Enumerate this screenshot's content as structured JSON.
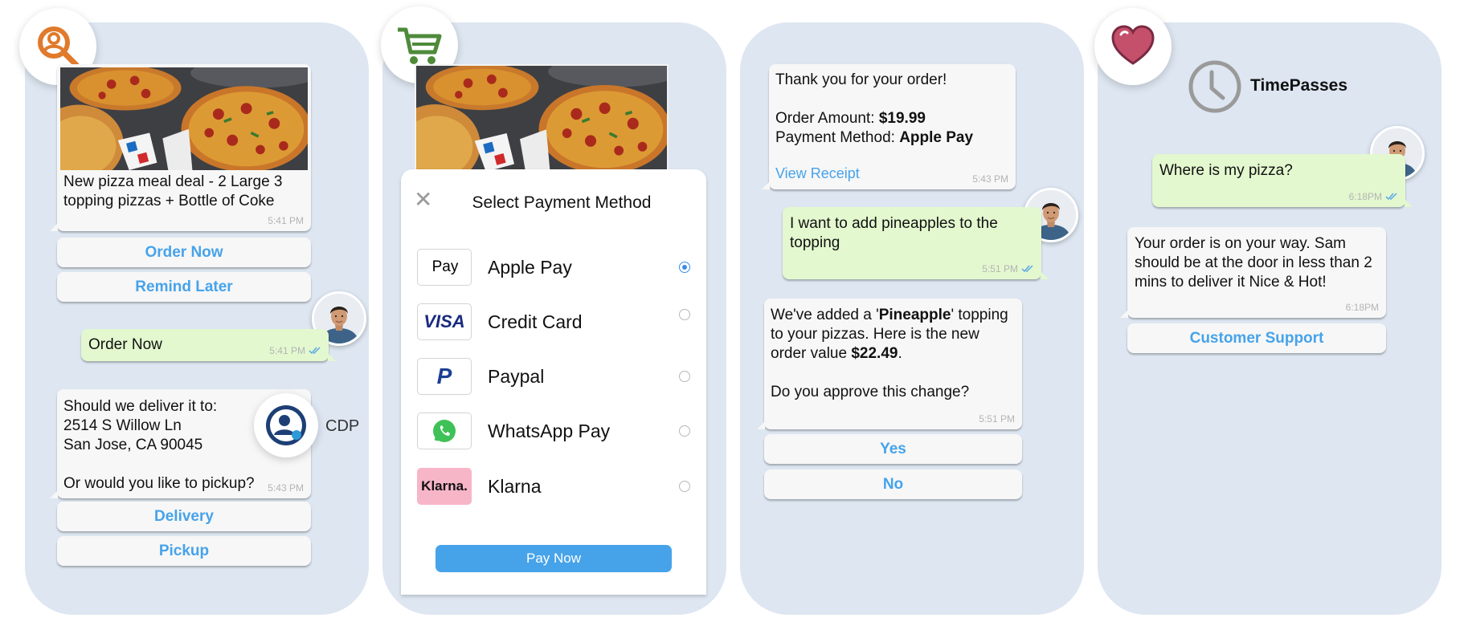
{
  "panel1": {
    "deal_card": {
      "text": "New pizza meal deal - 2 Large 3 topping pizzas + Bottle of Coke",
      "time": "5:41 PM"
    },
    "order_now_button": "Order Now",
    "remind_later_button": "Remind Later",
    "user_reply": {
      "text": "Order Now",
      "time": "5:41 PM"
    },
    "delivery_question": {
      "line1": "Should we deliver it to:",
      "line2": "2514 S Willow Ln",
      "line3": "San Jose, CA 90045",
      "line4": "Or would you like to pickup?",
      "time": "5:43 PM"
    },
    "cdp_label": "CDP",
    "delivery_button": "Delivery",
    "pickup_button": "Pickup"
  },
  "panel2": {
    "sheet_title": "Select Payment Method",
    "methods": [
      {
        "icon": "apple-pay-logo",
        "logo_text": "Pay",
        "label": "Apple Pay",
        "selected": true
      },
      {
        "icon": "visa-logo",
        "logo_text": "VISA",
        "label": "Credit Card",
        "selected": false
      },
      {
        "icon": "paypal-logo",
        "logo_text": "P",
        "label": "Paypal",
        "selected": false
      },
      {
        "icon": "whatsapp-logo",
        "logo_text": "",
        "label": "WhatsApp Pay",
        "selected": false
      },
      {
        "icon": "klarna-logo",
        "logo_text": "Klarna.",
        "label": "Klarna",
        "selected": false
      }
    ],
    "pay_button": "Pay Now"
  },
  "panel3": {
    "confirmation": {
      "line1": "Thank you for your order!",
      "amount_label": "Order Amount: ",
      "amount_value": "$19.99",
      "method_label": "Payment Method: ",
      "method_value": "Apple Pay",
      "link": "View Receipt",
      "time": "5:43 PM"
    },
    "user_request": {
      "text": "I want to add pineapples to the topping",
      "time": "5:51 PM"
    },
    "change_message": {
      "p1_a": "We've added a '",
      "p1_bold": "Pineapple",
      "p1_b": "' topping to your pizzas. Here is the new order value ",
      "p1_value": "$22.49",
      "p1_end": ".",
      "p2": "Do you approve this change?",
      "time": "5:51 PM"
    },
    "yes_button": "Yes",
    "no_button": "No"
  },
  "panel4": {
    "time_label": "TimePasses",
    "user_question": {
      "text": "Where is my pizza?",
      "time": "6:18PM"
    },
    "status_reply": {
      "text": "Your order is on your way. Sam should be at the door in less than 2 mins to deliver it Nice & Hot!",
      "time": "6:18PM"
    },
    "support_button": "Customer Support"
  },
  "colors": {
    "panel_bg": "#dde6f1",
    "button_text": "#46a3ea",
    "pay_button": "#46a3ea",
    "outgoing_bubble": "#e3f8cf",
    "search_badge": "#e07a2c",
    "cart_badge": "#4f8a3a",
    "heart_badge": "#c4506c"
  }
}
